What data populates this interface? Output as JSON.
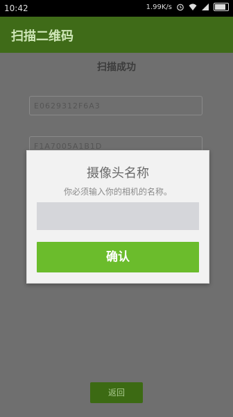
{
  "status_bar": {
    "time": "10:42",
    "speed": "1.99K/s"
  },
  "app_bar": {
    "title": "扫描二维码"
  },
  "page": {
    "success_text": "扫描成功",
    "field1_value": "E0629312F6A3",
    "field2_value": "F1A7005A1B1D",
    "back_label": "返回"
  },
  "dialog": {
    "title": "摄像头名称",
    "message": "你必须输入你的相机的名称。",
    "input_value": "",
    "confirm_label": "确认"
  },
  "colors": {
    "app_bar": "#3f6b18",
    "confirm_button": "#6bbc2c",
    "back_button": "#3c6a13"
  }
}
